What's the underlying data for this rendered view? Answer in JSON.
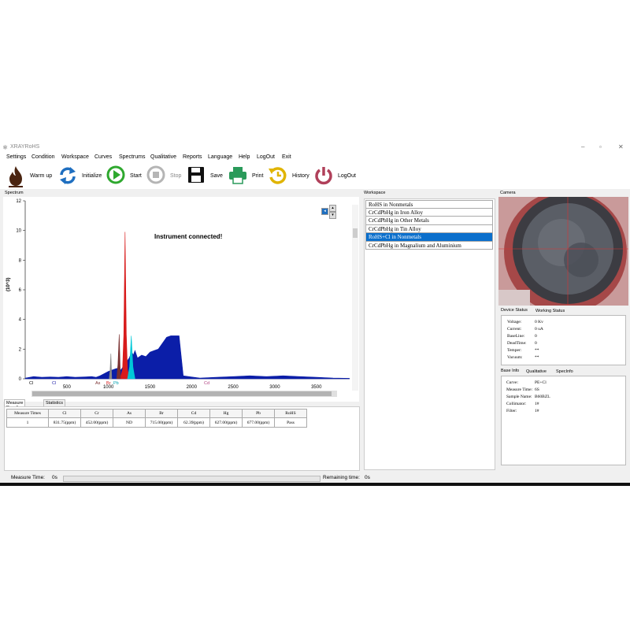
{
  "window": {
    "title": "XRAYRoHS",
    "icon": "xray-app-icon"
  },
  "menu": [
    "Settings",
    "Condition",
    "Workspace",
    "Curves",
    "Spectrums",
    "Qualitative",
    "Reports",
    "Language",
    "Help",
    "LogOut",
    "Exit"
  ],
  "toolbar": {
    "warmup": "Warm up",
    "initialize": "Initialize",
    "start": "Start",
    "stop": "Stop",
    "save": "Save",
    "print": "Print",
    "history": "History",
    "logout": "LogOut"
  },
  "spectrum": {
    "caption": "Spectrum",
    "message": "Instrument connected!",
    "ylabel": "(10^3)",
    "y_ticks": [
      "0",
      "2",
      "4",
      "6",
      "8",
      "10",
      "12"
    ],
    "x_ticks": [
      "500",
      "1000",
      "1500",
      "2000",
      "2500",
      "3000",
      "3500"
    ],
    "element_labels": {
      "cl": "Cl",
      "cl2": "Cl",
      "as": "As",
      "br": "Br",
      "pb": "Pb",
      "cd": "Cd"
    }
  },
  "chart_data": {
    "type": "area",
    "title": "",
    "xlabel": "",
    "ylabel": "(10^3)",
    "xlim": [
      0,
      3900
    ],
    "ylim": [
      0,
      12
    ],
    "grid": false,
    "series": [
      {
        "name": "",
        "color": "#0b1ea8",
        "x": [
          0,
          100,
          200,
          300,
          400,
          500,
          600,
          700,
          800,
          850,
          900,
          950,
          1000,
          1050,
          1100,
          1150,
          1200,
          1250,
          1280,
          1300,
          1320,
          1350,
          1400,
          1450,
          1500,
          1550,
          1600,
          1650,
          1700,
          1750,
          1800,
          1850,
          1900,
          2000,
          2100,
          2300,
          2500,
          2700,
          2900,
          3100,
          3300,
          3500,
          3700,
          3900
        ],
        "y": [
          0.05,
          0.15,
          0.1,
          0.12,
          0.1,
          0.15,
          0.1,
          0.12,
          0.15,
          0.1,
          0.2,
          0.35,
          0.5,
          0.6,
          0.7,
          0.6,
          1.0,
          1.4,
          1.8,
          1.6,
          1.9,
          1.4,
          1.6,
          1.5,
          1.8,
          1.9,
          2.0,
          2.4,
          2.8,
          2.9,
          2.9,
          2.9,
          0.2,
          0.12,
          0.05,
          0.1,
          0.15,
          0.2,
          0.15,
          0.2,
          0.15,
          0.1,
          0.05,
          0.03
        ]
      },
      {
        "name": "",
        "color": "#d81b1b",
        "x": [
          1140,
          1170,
          1185,
          1200,
          1215,
          1230,
          1260
        ],
        "y": [
          0,
          0.6,
          3.0,
          9.9,
          3.0,
          0.6,
          0
        ]
      },
      {
        "name": "",
        "color": "#00c8d8",
        "x": [
          1230,
          1255,
          1275,
          1295,
          1320
        ],
        "y": [
          0,
          0.8,
          2.9,
          0.8,
          0
        ]
      },
      {
        "name": "",
        "color": "#7a3030",
        "x": [
          1100,
          1115,
          1130,
          1145
        ],
        "y": [
          0,
          1.0,
          3.0,
          0
        ]
      },
      {
        "name": "",
        "color": "#888888",
        "x": [
          1010,
          1020,
          1030,
          1040
        ],
        "y": [
          0,
          0.6,
          1.7,
          0
        ]
      }
    ]
  },
  "results": {
    "tabs": [
      "Measure Results",
      "Statistics"
    ],
    "headers": [
      "Measure Times",
      "Cl",
      "Cr",
      "As",
      "Br",
      "Cd",
      "Hg",
      "Pb",
      "RoHS"
    ],
    "rows": [
      [
        "1",
        "831.75(ppm)",
        "452.00(ppm)",
        "ND",
        "715.00(ppm)",
        "62.39(ppm)",
        "627.00(ppm)",
        "677.00(ppm)",
        "Pass"
      ]
    ]
  },
  "workspace": {
    "caption": "Workspace",
    "items": [
      "RoHS in Nonmetals",
      "CrCdPbHg in Iron Alloy",
      "CrCdPbHg in Other Metals",
      "CrCdPbHg in Tin Alloy",
      "RoHS+Cl in Nonmetals",
      "CrCdPbHg in Magnalium and Aluminium"
    ],
    "selected_index": 4
  },
  "camera": {
    "caption": "Camera"
  },
  "device": {
    "tabs": [
      "Device Status",
      "Working Status"
    ],
    "rows": [
      {
        "k": "Voltage:",
        "v": "0 Kv"
      },
      {
        "k": "Current:",
        "v": "0 uA"
      },
      {
        "k": "BaseLine:",
        "v": "0"
      },
      {
        "k": "DeadTime:",
        "v": "0"
      },
      {
        "k": "Temper:",
        "v": "**"
      },
      {
        "k": "Vacuum:",
        "v": "**"
      }
    ]
  },
  "baseinfo": {
    "tabs": [
      "Base Info",
      "Qualitative",
      "SpecInfo"
    ],
    "rows": [
      {
        "k": "Curve:",
        "v": "PE+Cl"
      },
      {
        "k": "Measure Time:",
        "v": "6S"
      },
      {
        "k": "Sample Name:",
        "v": "B60BZL"
      },
      {
        "k": "Collimator:",
        "v": "1#"
      },
      {
        "k": "Filter:",
        "v": "1#"
      }
    ]
  },
  "status": {
    "measure_label": "Measure Time:",
    "measure_val": "0s",
    "remaining_label": "Remaining time:",
    "remaining_val": "0s"
  }
}
